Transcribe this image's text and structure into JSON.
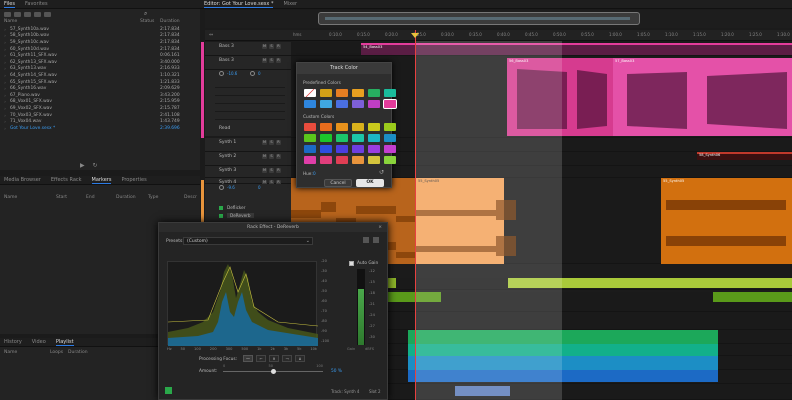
{
  "files_panel": {
    "tabs": [
      "Files",
      "Favorites"
    ],
    "columns": {
      "name": "Name",
      "status": "Status",
      "duration": "Duration"
    },
    "rows": [
      {
        "name": "57_Synth10a.wav",
        "duration": "2:17.834"
      },
      {
        "name": "58_Synth10b.wav",
        "duration": "2:17.834"
      },
      {
        "name": "59_Synth10c.wav",
        "duration": "2:17.834"
      },
      {
        "name": "60_Synth10d.wav",
        "duration": "2:17.834"
      },
      {
        "name": "61_Synth11_SFX.wav",
        "duration": "0:06.161"
      },
      {
        "name": "62_Synth13_SFX.wav",
        "duration": "3:40.000"
      },
      {
        "name": "63_Synth13.wav",
        "duration": "2:16.933"
      },
      {
        "name": "64_Synth14_SFX.wav",
        "duration": "1:10.321"
      },
      {
        "name": "65_Synth15_SFX.wav",
        "duration": "1:21.833"
      },
      {
        "name": "66_Synth16.wav",
        "duration": "2:09.629"
      },
      {
        "name": "67_Piano.wav",
        "duration": "3:43.200"
      },
      {
        "name": "68_Vox01_SFX.wav",
        "duration": "2:15.959"
      },
      {
        "name": "69_Vox02_SFX.wav",
        "duration": "2:15.787"
      },
      {
        "name": "70_Vox03_SFX.wav",
        "duration": "2:41.108"
      },
      {
        "name": "71_Vox04.wav",
        "duration": "1:43.749"
      },
      {
        "name": "Got Your Love.sesx *",
        "duration": "2:39.696",
        "highlight": true
      }
    ]
  },
  "markers_panel": {
    "tabs": [
      "Media Browser",
      "Effects Rack",
      "Markers",
      "Properties"
    ],
    "columns": [
      "Name",
      "Start",
      "End",
      "Duration",
      "Type",
      "Descr"
    ]
  },
  "history_panel": {
    "tabs": [
      "History",
      "Video",
      "Playlist"
    ],
    "columns": [
      "Name",
      "Loops",
      "Duration"
    ]
  },
  "editor": {
    "tabs": [
      "Editor: Got Your Love.sesx *",
      "Mixer"
    ],
    "ruler_unit": "hms",
    "ruler_ticks": [
      "0:10.0",
      "0:15.0",
      "0:20.0",
      "0:25.0",
      "0:30.0",
      "0:35.0",
      "0:40.0",
      "0:45.0",
      "0:50.0",
      "0:55.0",
      "1:00.0",
      "1:05.0",
      "1:10.0",
      "1:15.0",
      "1:20.0",
      "1:25.0",
      "1:30.0"
    ],
    "tracks": [
      {
        "name": "Bass 3"
      },
      {
        "name": "Bass 3"
      },
      {
        "name": "Synth 1"
      },
      {
        "name": "Synth 2"
      },
      {
        "name": "Synth 3"
      },
      {
        "name": "Synth 4"
      }
    ],
    "track_controls": {
      "volume": "-10.6",
      "pan": "0",
      "volume2": "-9.6",
      "pan2": "0",
      "mode": "Read"
    },
    "fx_slots": [
      "Deflicker",
      "DeReverb"
    ],
    "clips": {
      "bass_top": "54_Bass03",
      "bass_a": "56_Bass03",
      "bass_b": "57_Bass03",
      "synth_a": "56_Synth04",
      "synth_b": "55_Synth05",
      "synth_orange": "55_Synth05",
      "synth_c": "58_Synth06",
      "pan": "Pan"
    }
  },
  "track_color_dialog": {
    "title": "Track Color",
    "predefined_label": "Predefined Colors",
    "custom_label": "Custom Colors",
    "hue_label": "Hue:",
    "hue_value": "0",
    "cancel": "Cancel",
    "ok": "OK",
    "predefined": [
      "#ffffff",
      "#d4a017",
      "#e67e22",
      "#e8a020",
      "#27ae60",
      "#1abc9c",
      "#2e86de",
      "#3fa7e0",
      "#4a6fe0",
      "#7d5fd8",
      "#c03ec5",
      "#e33c9b"
    ],
    "custom": [
      "#e84c3d",
      "#e86c1c",
      "#e8921c",
      "#d9b21c",
      "#c9c91c",
      "#9bcb1c",
      "#5bc51c",
      "#1cc52b",
      "#1cc56b",
      "#1cc5a8",
      "#1cb5c5",
      "#1c8ec5",
      "#1c6ac5",
      "#2c4ee0",
      "#4a3ee0",
      "#6e3ee0",
      "#9a3ee0",
      "#c43ed0",
      "#e03ea8",
      "#e03e7c",
      "#e03e54",
      "#e8943c",
      "#d4c43c",
      "#8ad43c"
    ]
  },
  "rack_effect": {
    "title": "Rack Effect - DeReverb",
    "presets_label": "Presets:",
    "presets_value": "(Custom)",
    "auto_gain": "Auto Gain",
    "db_labels": [
      "-20",
      "-30",
      "-40",
      "-50",
      "-60",
      "-70",
      "-80",
      "-90",
      "-100"
    ],
    "meter_labels": [
      "-12",
      "-15",
      "-18",
      "-21",
      "-24",
      "-27",
      "-30"
    ],
    "freq_labels": [
      "Hz",
      "50",
      "100",
      "200",
      "300",
      "500",
      "1k",
      "2k",
      "3k",
      "5k",
      "10k"
    ],
    "gain_label": "Gain",
    "db_unit": "dBFS",
    "processing_focus": "Processing Focus:",
    "amount_label": "Amount:",
    "amount_value": "50 %",
    "amount_scale": [
      "0",
      "50",
      "100"
    ],
    "amount_fraction": 0.5,
    "footer_track": "Track: Synth 4",
    "footer_slot": "Slot 2"
  }
}
